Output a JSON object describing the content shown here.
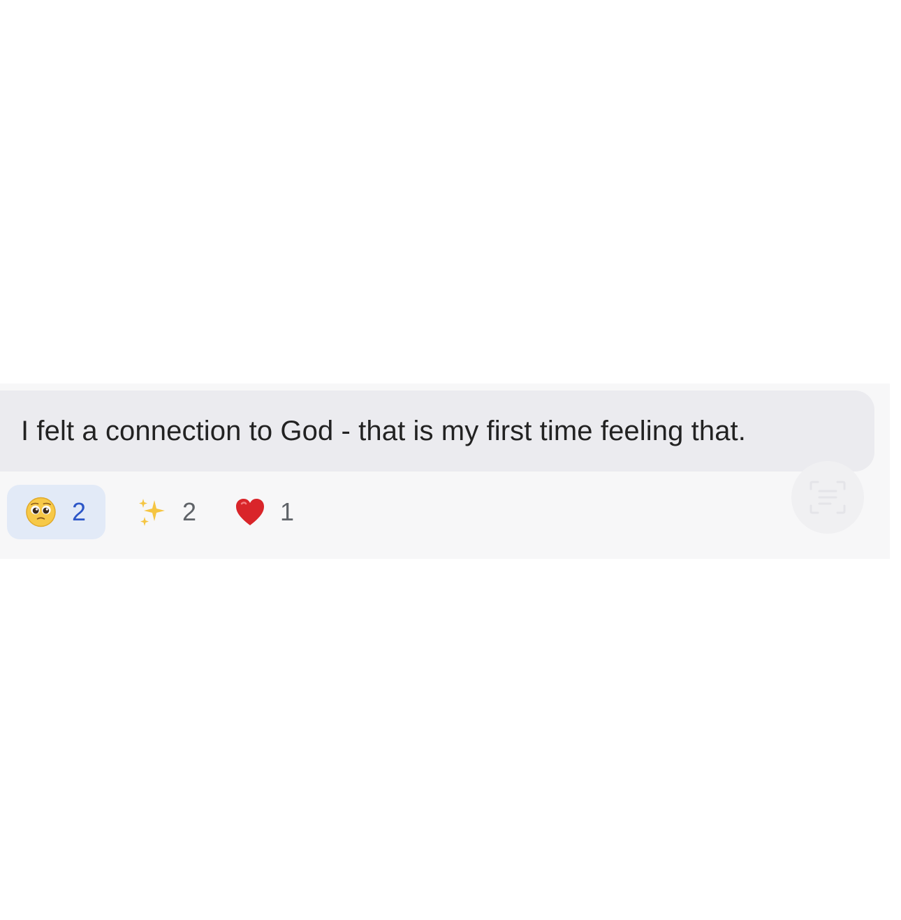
{
  "message": {
    "text": "I felt a connection to God - that is my first time feeling that."
  },
  "reactions": [
    {
      "emoji": "pleading-face-icon",
      "count": "2",
      "selected": true
    },
    {
      "emoji": "sparkles-icon",
      "count": "2",
      "selected": false
    },
    {
      "emoji": "red-heart-icon",
      "count": "1",
      "selected": false
    }
  ],
  "colors": {
    "page_background": "#ffffff",
    "panel_background": "#f7f7f8",
    "bubble_background": "#ebebef",
    "selected_reaction_background": "#e2eaf7",
    "selected_count_color": "#2c56c7",
    "count_color": "#5f6368",
    "text_color": "#222222"
  },
  "icons": {
    "scan_text_button": "text-scan-icon"
  }
}
